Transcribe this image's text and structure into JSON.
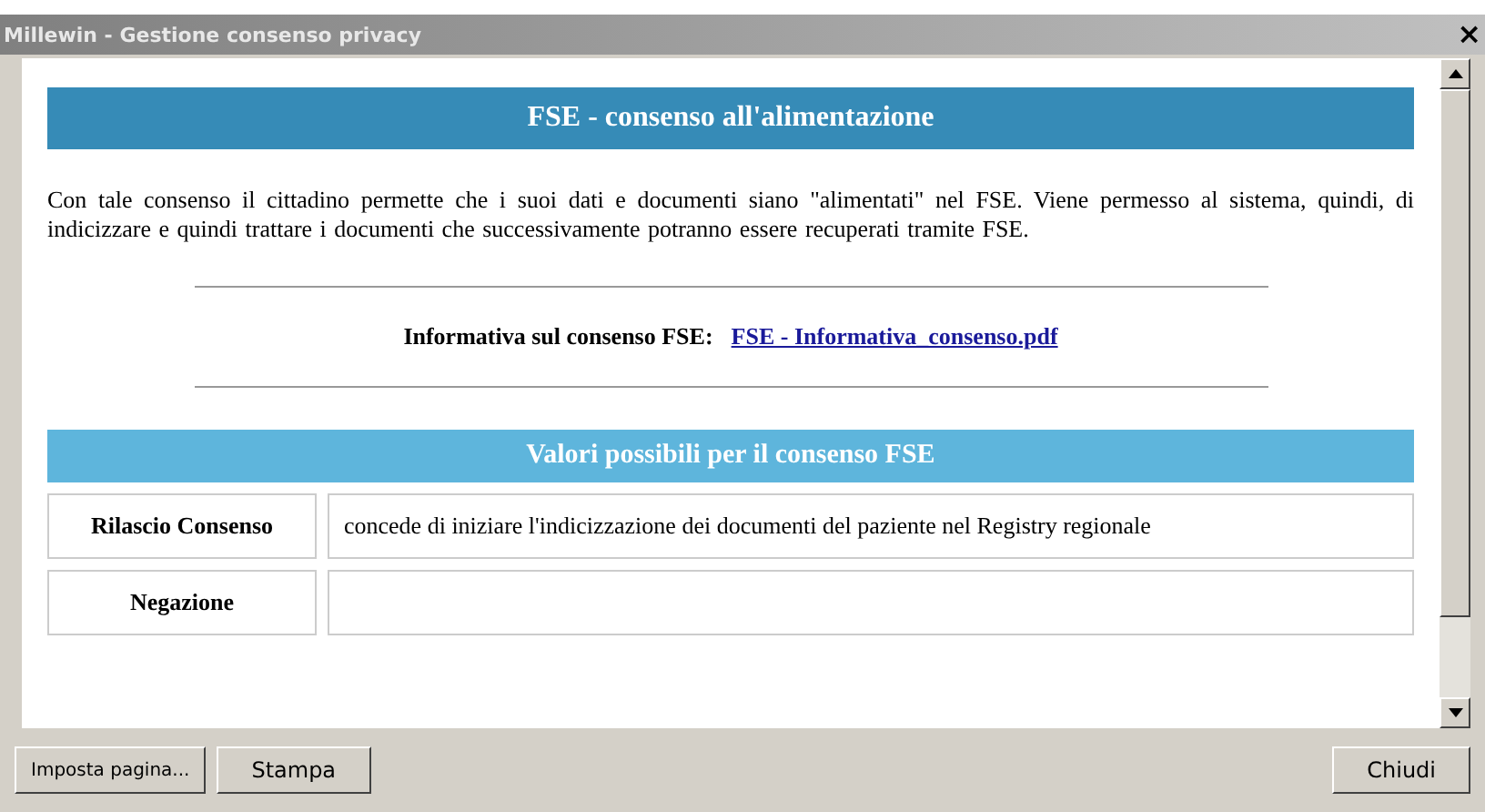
{
  "window": {
    "title": "Millewin - Gestione consenso privacy",
    "close": "×"
  },
  "content": {
    "heading": "FSE - consenso all'alimentazione",
    "description": "Con tale consenso il cittadino permette che i suoi dati e documenti siano \"alimentati\" nel FSE. Viene permesso al sistema, quindi, di indicizzare e quindi trattare i documenti che successivamente potranno essere recuperati tramite FSE.",
    "info_label": "Informativa sul consenso FSE:",
    "info_link": "FSE - Informativa_consenso.pdf",
    "values_heading": "Valori possibili per il consenso FSE",
    "rows": [
      {
        "name": "Rilascio Consenso",
        "description": "concede di iniziare l'indicizzazione dei documenti del paziente nel Registry regionale"
      },
      {
        "name": "Negazione",
        "description": ""
      }
    ]
  },
  "buttons_left": [
    "Imposta pagina...",
    "Stampa"
  ],
  "buttons_right": [
    "Chiudi"
  ]
}
